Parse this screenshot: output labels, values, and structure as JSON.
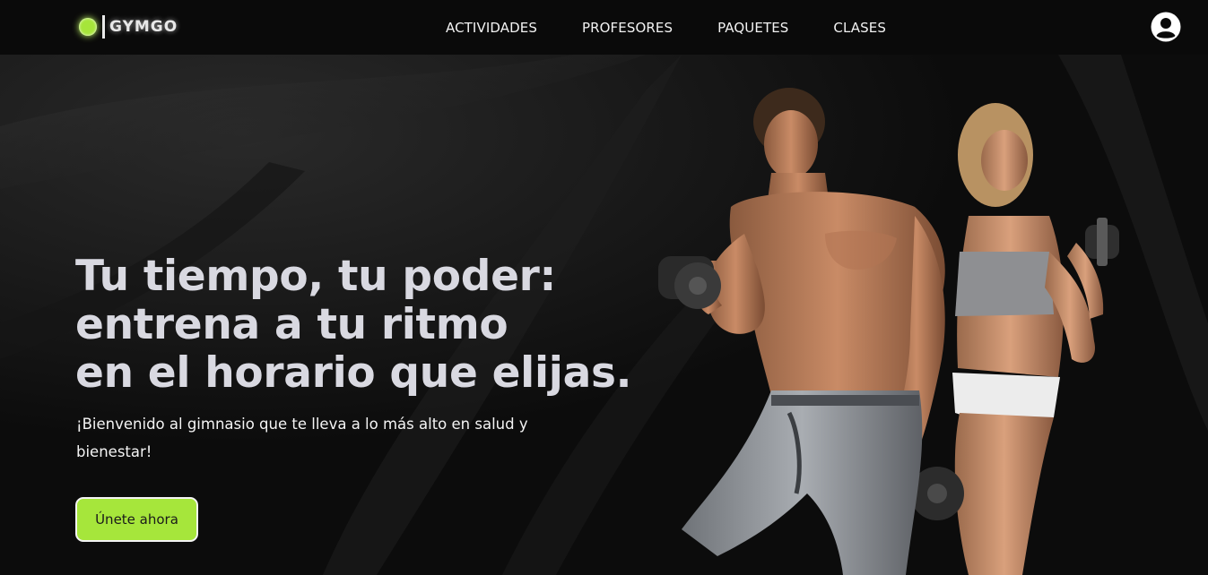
{
  "brand": {
    "name": "GYMGO",
    "accent": "#a6e53a"
  },
  "nav": {
    "links": [
      "ACTIVIDADES",
      "PROFESORES",
      "PAQUETES",
      "CLASES"
    ]
  },
  "header": {
    "user_icon": "user-circle-icon"
  },
  "hero": {
    "title_lines": [
      "Tu tiempo, tu poder:",
      "entrena a tu ritmo",
      "en el horario que elijas."
    ],
    "subtitle": "¡Bienvenido al gimnasio que te lleva a lo más alto en salud y bienestar!",
    "cta_label": "Únete ahora",
    "cta_color": "#a6e63b",
    "image": "fitness-couple-with-dumbbells-photo"
  }
}
